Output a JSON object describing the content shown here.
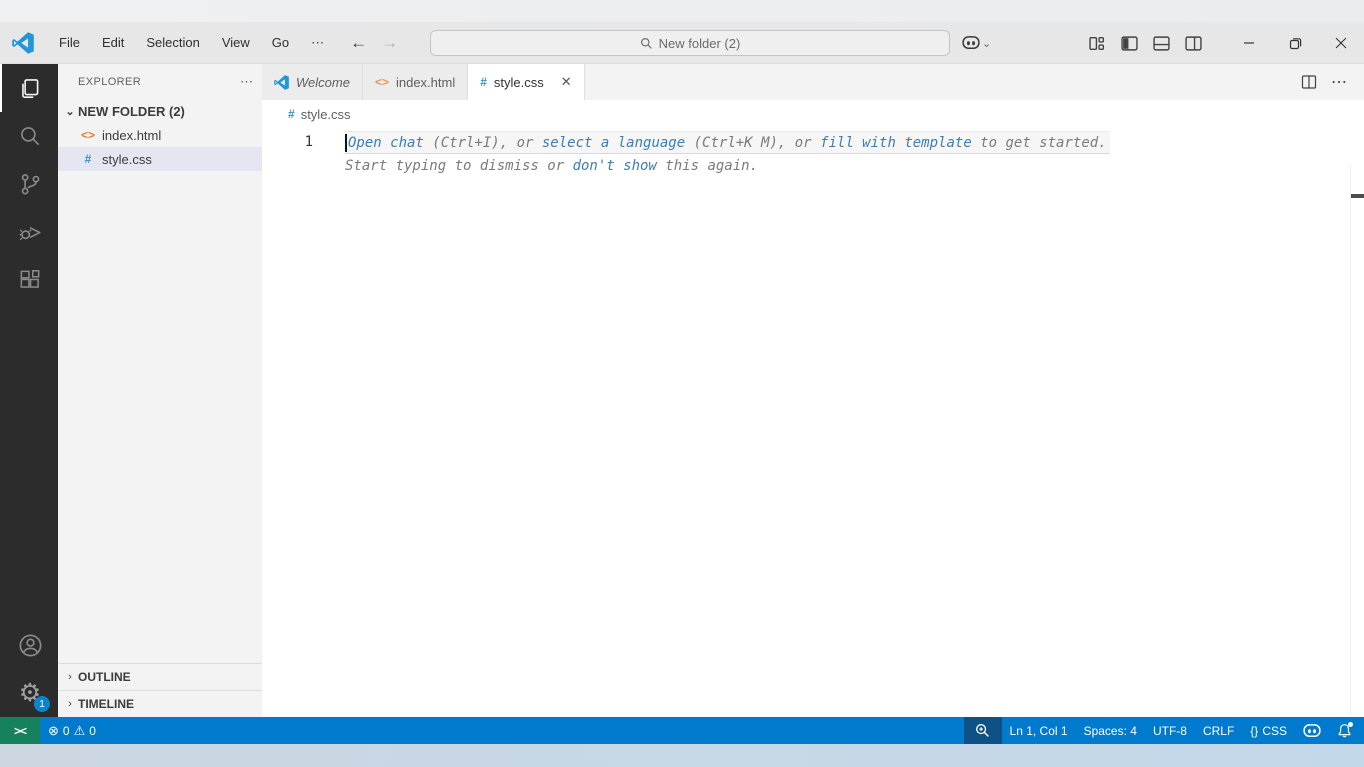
{
  "title_bar": {
    "menus": [
      "File",
      "Edit",
      "Selection",
      "View",
      "Go"
    ],
    "more_label": "⋯",
    "back_glyph": "←",
    "forward_glyph": "→",
    "search_text": "New folder (2)",
    "chevron_glyph": "⌄"
  },
  "activity_bar": {
    "items": [
      "explorer",
      "search",
      "source-control",
      "run-and-debug",
      "extensions"
    ],
    "settings_badge": "1",
    "gear_glyph": "⚙"
  },
  "sidebar": {
    "header": "EXPLORER",
    "more_label": "⋯",
    "folder_chevron": "⌄",
    "folder_label": "NEW FOLDER (2)",
    "files": [
      {
        "name": "index.html",
        "icon_glyph": "<>"
      },
      {
        "name": "style.css",
        "icon_glyph": "#"
      }
    ],
    "section_chevron": "›",
    "sections": [
      "OUTLINE",
      "TIMELINE"
    ]
  },
  "editor": {
    "tabs": [
      {
        "label": "Welcome"
      },
      {
        "label": "index.html",
        "icon_glyph": "<>"
      },
      {
        "label": "style.css",
        "icon_glyph": "#",
        "close_glyph": "✕"
      }
    ],
    "tabbar_more": "⋯",
    "breadcrumb": {
      "icon_glyph": "#",
      "label": "style.css"
    },
    "line_number": "1",
    "ghost_line1": [
      {
        "text": "Open chat",
        "link": true
      },
      {
        "text": " (Ctrl+I), or ",
        "link": false
      },
      {
        "text": "select a language",
        "link": true
      },
      {
        "text": " (Ctrl+K M), or ",
        "link": false
      },
      {
        "text": "fill with template",
        "link": true
      },
      {
        "text": " to get started.",
        "link": false
      }
    ],
    "ghost_line2": [
      {
        "text": "Start typing to dismiss or ",
        "link": false
      },
      {
        "text": "don't show",
        "link": true
      },
      {
        "text": " this again.",
        "link": false
      }
    ]
  },
  "status_bar": {
    "remote_glyph": "><",
    "error_glyph": "⊗",
    "errors": "0",
    "warning_glyph": "⚠",
    "warnings": "0",
    "cursor_position": "Ln 1, Col 1",
    "indentation": "Spaces: 4",
    "encoding": "UTF-8",
    "eol": "CRLF",
    "braces_glyph": "{}",
    "language": "CSS"
  },
  "colors": {
    "accent": "#007acc",
    "remote_green": "#16825d",
    "activity_bar": "#2c2c2c",
    "selection": "#e4e6f1",
    "ghost_link": "#3c7eb0"
  }
}
